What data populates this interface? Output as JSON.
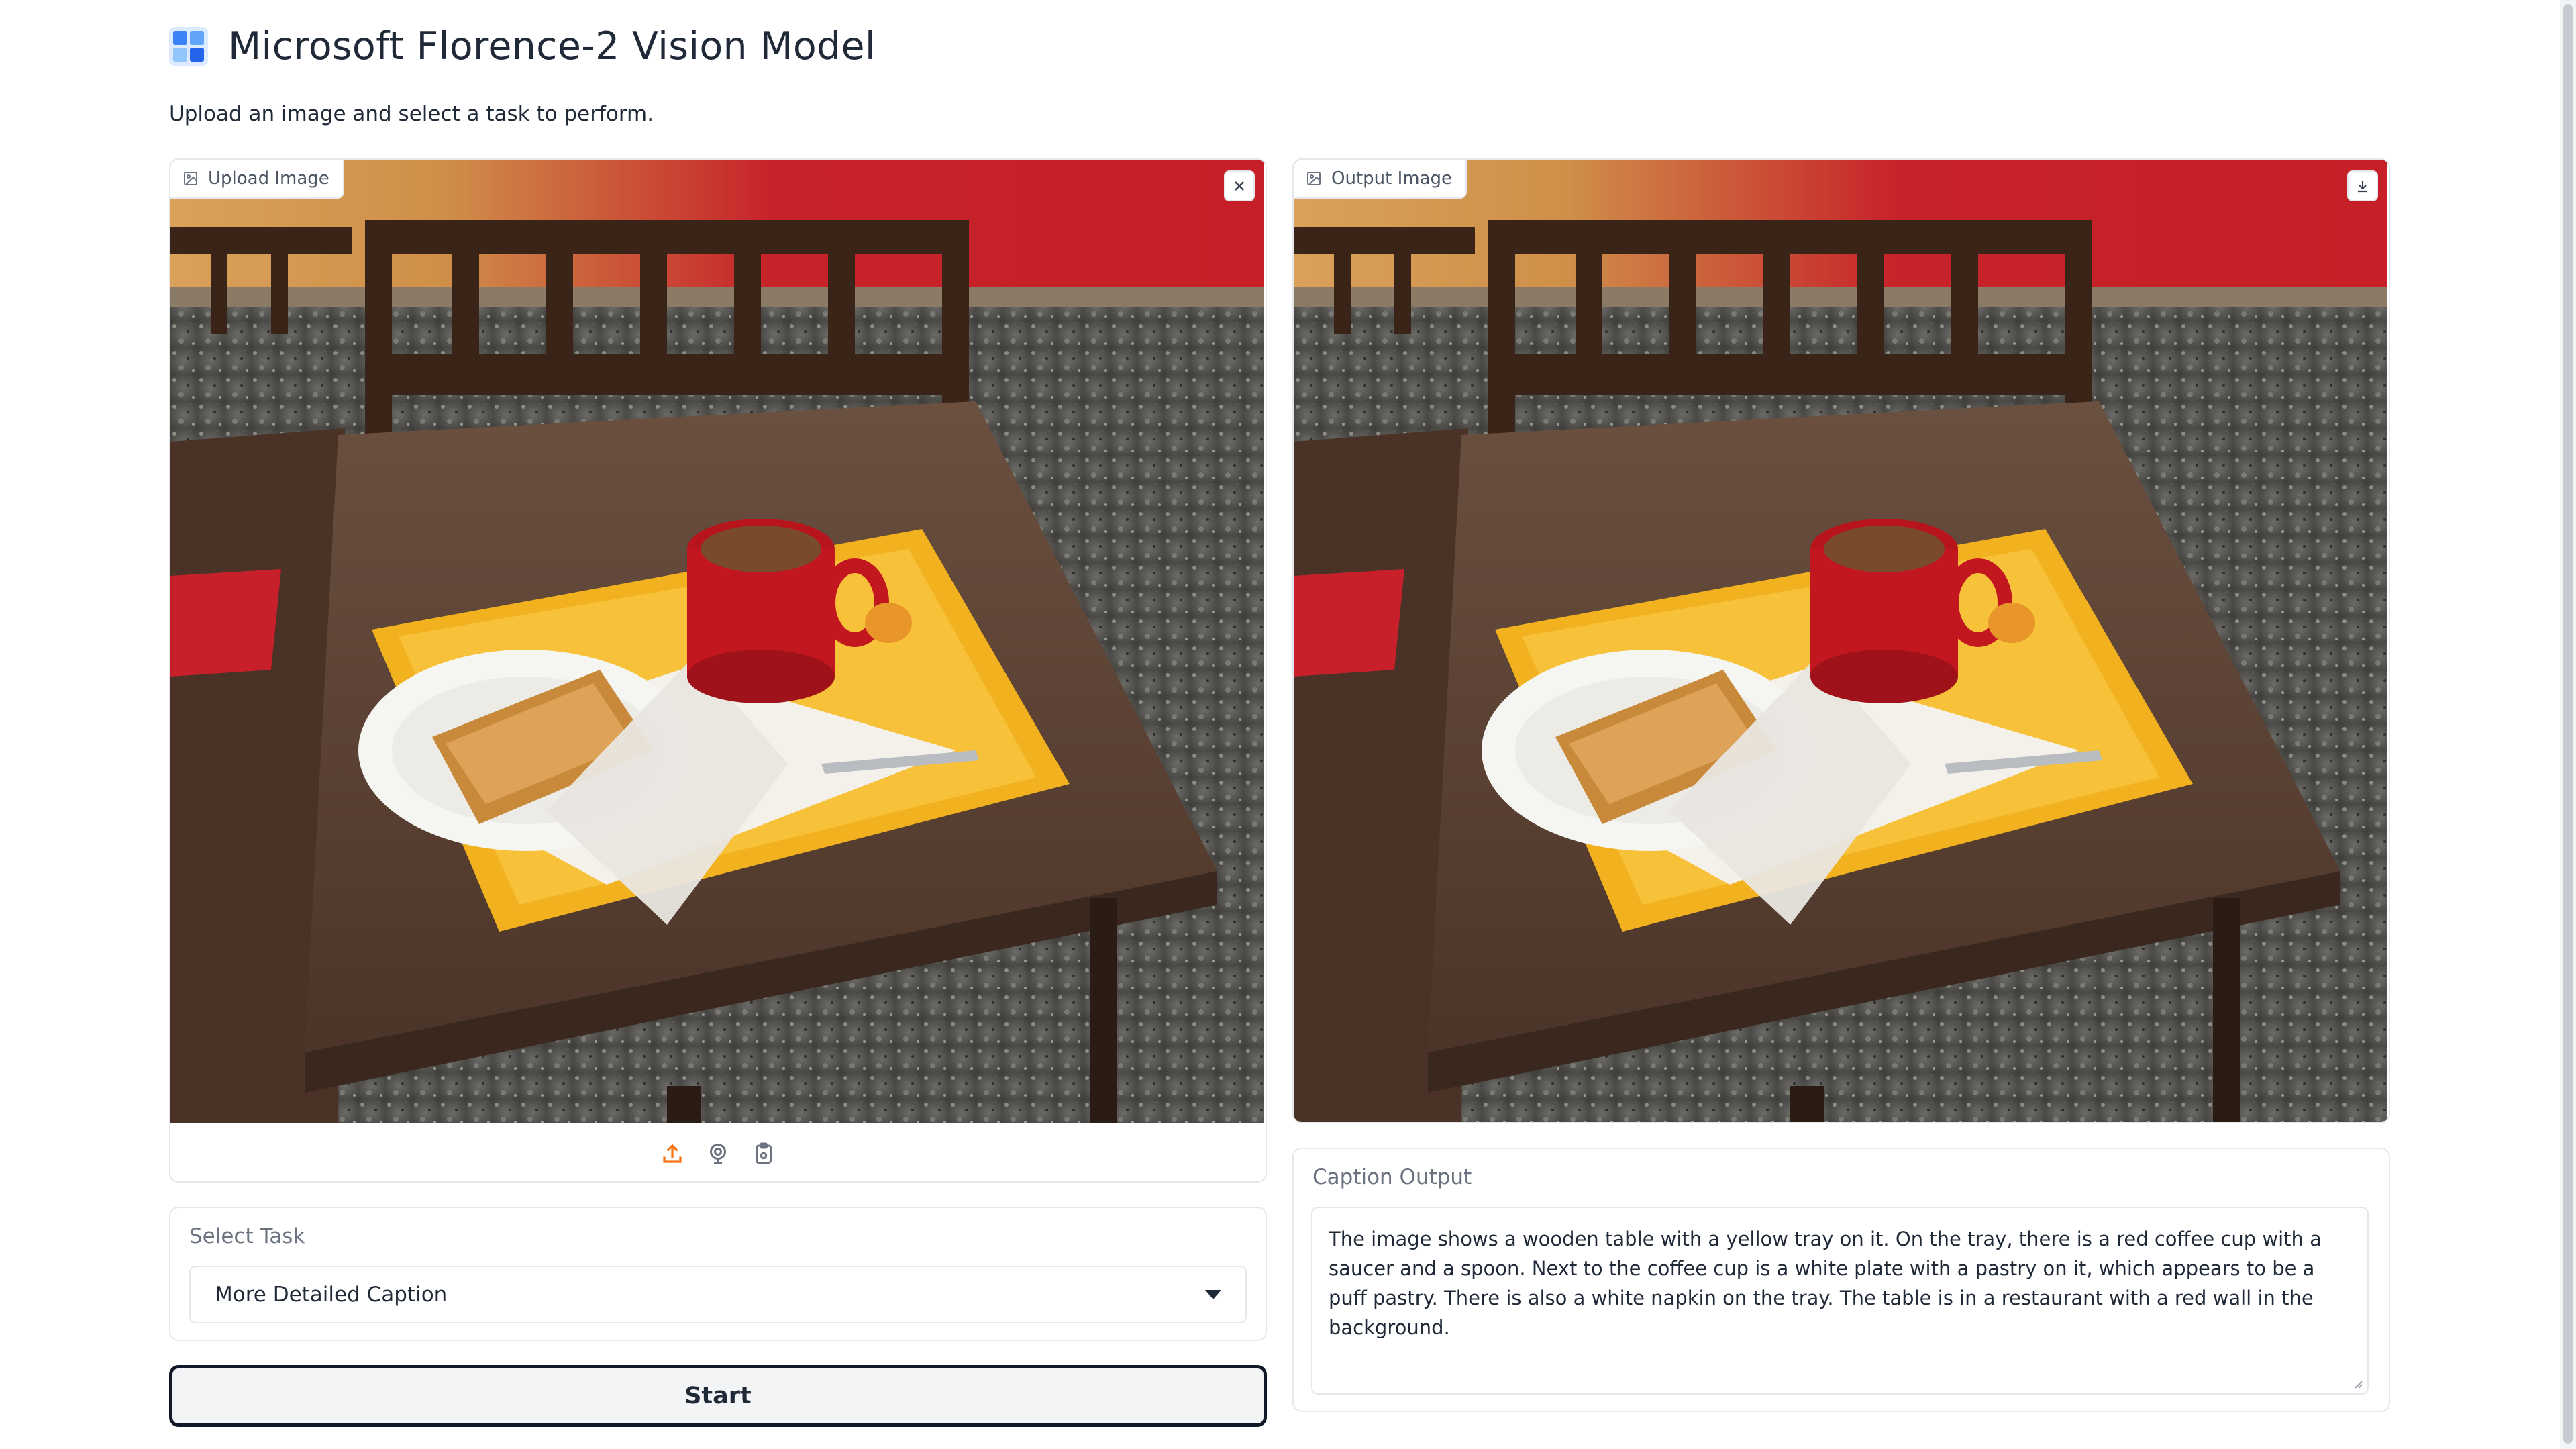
{
  "app": {
    "title": "Microsoft Florence-2 Vision Model",
    "subtitle": "Upload an image and select a task to perform.",
    "logo_icon": "windows-logo-icon"
  },
  "upload_panel": {
    "label": "Upload Image",
    "clear_icon": "close-icon",
    "sources": [
      "upload-icon",
      "webcam-icon",
      "clipboard-icon"
    ]
  },
  "output_panel": {
    "label": "Output Image",
    "download_icon": "download-icon"
  },
  "task": {
    "label": "Select Task",
    "selected": "More Detailed Caption"
  },
  "start_button": {
    "label": "Start"
  },
  "caption": {
    "label": "Caption Output",
    "value": "The image shows a wooden table with a yellow tray on it. On the tray, there is a red coffee cup with a saucer and a spoon. Next to the coffee cup is a white plate with a pastry on it, which appears to be a puff pastry. There is also a white napkin on the tray. The table is in a restaurant with a red wall in the background."
  },
  "colors": {
    "accent": "#f97316",
    "border": "#e5e7eb",
    "text": "#1f2937",
    "muted": "#6b7280"
  }
}
